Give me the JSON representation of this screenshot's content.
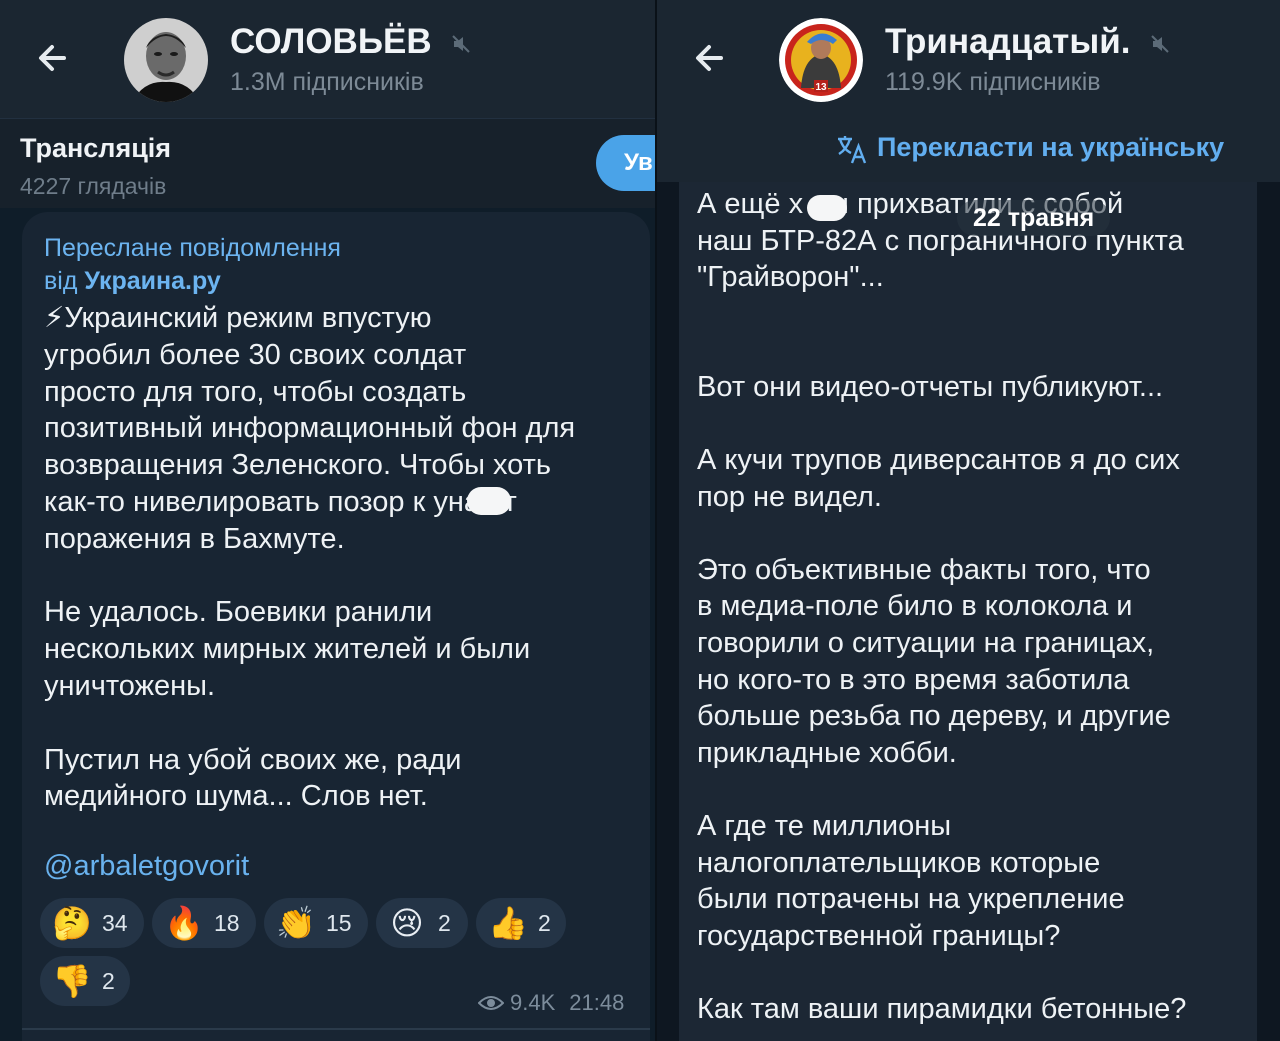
{
  "left": {
    "channel_title": "СОЛОВЬЁВ",
    "subscribers": "1.3M підписників",
    "live": {
      "title": "Трансляція",
      "viewers": "4227 глядачів",
      "join_label": "Ув"
    },
    "post": {
      "forward_label": "Переслане повідомлення",
      "forward_from_prefix": "від ",
      "forward_from": "Украина.ру",
      "paragraphs": [
        [
          "⚡Украинский режим впустую",
          "угробил более 30 своих солдат",
          "просто для того, чтобы создать",
          "позитивный информационный фон для",
          "возвращения Зеленского. Чтобы хоть",
          "как-то нивелировать позор к     уна от",
          "поражения в Бахмуте."
        ],
        [
          "Не удалось. Боевики ранили",
          "нескольких мирных жителей и были",
          "уничтожены."
        ],
        [
          "Пустил на убой своих же, ради",
          "медийного шума... Слов нет."
        ]
      ],
      "link": "@arbaletgovorit",
      "reactions": [
        {
          "emoji": "🤔",
          "count": "34"
        },
        {
          "emoji": "🔥",
          "count": "18"
        },
        {
          "emoji": "👏",
          "count": "15"
        },
        {
          "emoji": "😢",
          "count": "2"
        },
        {
          "emoji": "👍",
          "count": "2"
        },
        {
          "emoji": "👎",
          "count": "2"
        }
      ],
      "views": "9.4K",
      "time": "21:48"
    }
  },
  "right": {
    "channel_title": "Тринадцатый.",
    "subscribers": "119.9K підписників",
    "translate_label": "Перекласти на українську",
    "date_pill": "22 травня",
    "paragraphs": [
      [
        "А ещё х     лы прихватили с собой",
        "наш БТР-82А с пограничного пункта",
        "\"Грайворон\"..."
      ],
      [
        "Вот они видео-отчеты публикуют..."
      ],
      [
        "А кучи трупов диверсантов я до сих",
        "пор не видел."
      ],
      [
        "Это объективные факты того, что",
        "в медиа-поле  било в колокола и",
        "говорили о ситуации на границах,",
        "но кого-то в это время заботила",
        "больше резьба по дереву, и другие",
        "прикладные хобби."
      ],
      [
        "А где те миллионы",
        "налогоплательщиков которые",
        "были потрачены на укрепление",
        "государственной границы?"
      ],
      [
        "Как там ваши пирамидки бетонные?"
      ]
    ],
    "avatar_text": "13"
  },
  "colors": {
    "accent": "#62aef0",
    "header_bg": "#1b2631",
    "bubble_bg": "#182533"
  }
}
